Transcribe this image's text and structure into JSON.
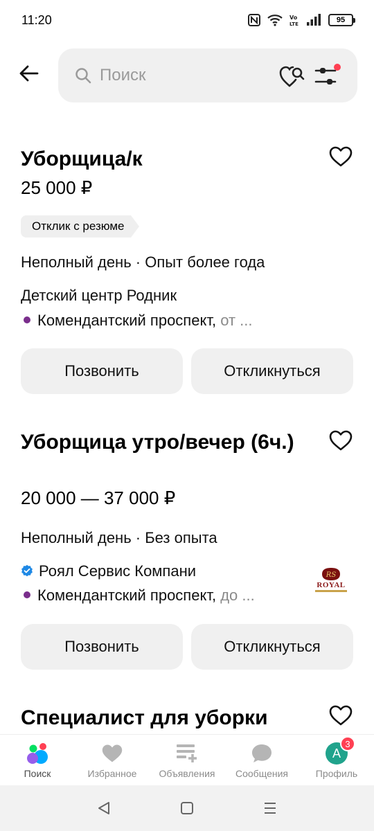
{
  "status_bar": {
    "time": "11:20",
    "battery": "95"
  },
  "search": {
    "placeholder": "Поиск"
  },
  "listings": [
    {
      "title": "Уборщица/к",
      "price": "25 000 ₽",
      "tag": "Отклик с резюме",
      "schedule": "Неполный день · Опыт более года",
      "company": "Детский центр Родник",
      "address": "Комендантский проспект,",
      "address_extra": "от ...",
      "call_label": "Позвонить",
      "respond_label": "Откликнуться"
    },
    {
      "title": "Уборщица утро/вечер (6ч.)",
      "price": "20 000 — 37 000 ₽",
      "schedule": "Неполный день · Без опыта",
      "company": "Роял Сервис Компани",
      "company_logo_text": "ROYAL",
      "address": "Комендантский проспект,",
      "address_extra": "до ...",
      "call_label": "Позвонить",
      "respond_label": "Откликнуться"
    },
    {
      "title": "Специалист для уборки"
    }
  ],
  "bottom_nav": {
    "items": [
      {
        "label": "Поиск"
      },
      {
        "label": "Избранное"
      },
      {
        "label": "Объявления"
      },
      {
        "label": "Сообщения"
      },
      {
        "label": "Профиль",
        "avatar": "А",
        "badge": "3"
      }
    ]
  },
  "colors": {
    "accent_red": "#ff4053",
    "metro_purple": "#7a2e8c",
    "avatar_green": "#20a38c",
    "verified_blue": "#1e88e5"
  }
}
